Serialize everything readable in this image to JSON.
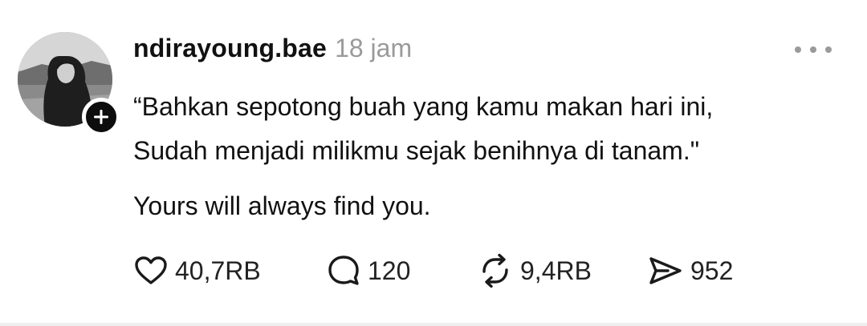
{
  "post": {
    "username": "ndirayoung.bae",
    "timestamp": "18 jam",
    "lines": [
      "“Bahkan sepotong buah yang kamu makan hari ini,",
      "Sudah menjadi milikmu sejak benihnya di tanam.\"",
      "Yours will always find you."
    ]
  },
  "actions": {
    "likes": "40,7RB",
    "replies": "120",
    "reposts": "9,4RB",
    "shares": "952"
  },
  "icons": {
    "avatar": "profile-photo",
    "follow": "plus-icon",
    "more": "more-dots-icon",
    "like": "heart-icon",
    "reply": "speech-bubble-icon",
    "repost": "repost-icon",
    "share": "send-icon"
  }
}
